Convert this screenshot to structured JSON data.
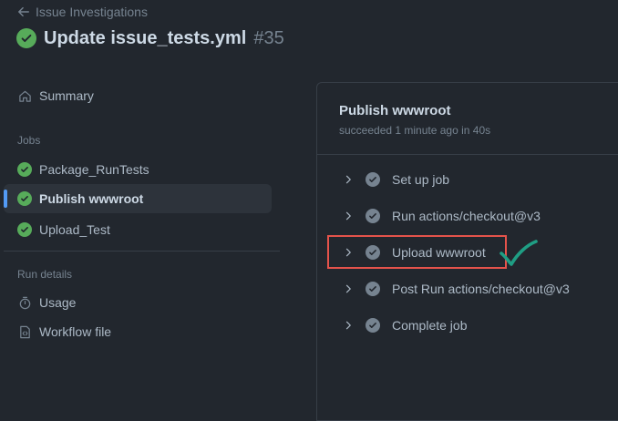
{
  "header": {
    "back_label": "Issue Investigations",
    "title": "Update issue_tests.yml",
    "run_number": "#35"
  },
  "sidebar": {
    "summary_label": "Summary",
    "jobs_heading": "Jobs",
    "jobs": [
      {
        "label": "Package_RunTests",
        "status": "success",
        "active": false
      },
      {
        "label": "Publish wwwroot",
        "status": "success",
        "active": true
      },
      {
        "label": "Upload_Test",
        "status": "success",
        "active": false
      }
    ],
    "run_details_heading": "Run details",
    "usage_label": "Usage",
    "workflow_file_label": "Workflow file"
  },
  "job": {
    "title": "Publish wwwroot",
    "subtitle": "succeeded 1 minute ago in 40s",
    "steps": [
      {
        "label": "Set up job",
        "status": "success"
      },
      {
        "label": "Run actions/checkout@v3",
        "status": "success"
      },
      {
        "label": "Upload wwwroot",
        "status": "success",
        "highlighted": true
      },
      {
        "label": "Post Run actions/checkout@v3",
        "status": "success"
      },
      {
        "label": "Complete job",
        "status": "success"
      }
    ]
  },
  "colors": {
    "background": "#22272e",
    "success": "#57ab5a",
    "accent": "#539bf5",
    "highlight_box": "#e5534b",
    "annotation_tick": "#1f9e84"
  }
}
